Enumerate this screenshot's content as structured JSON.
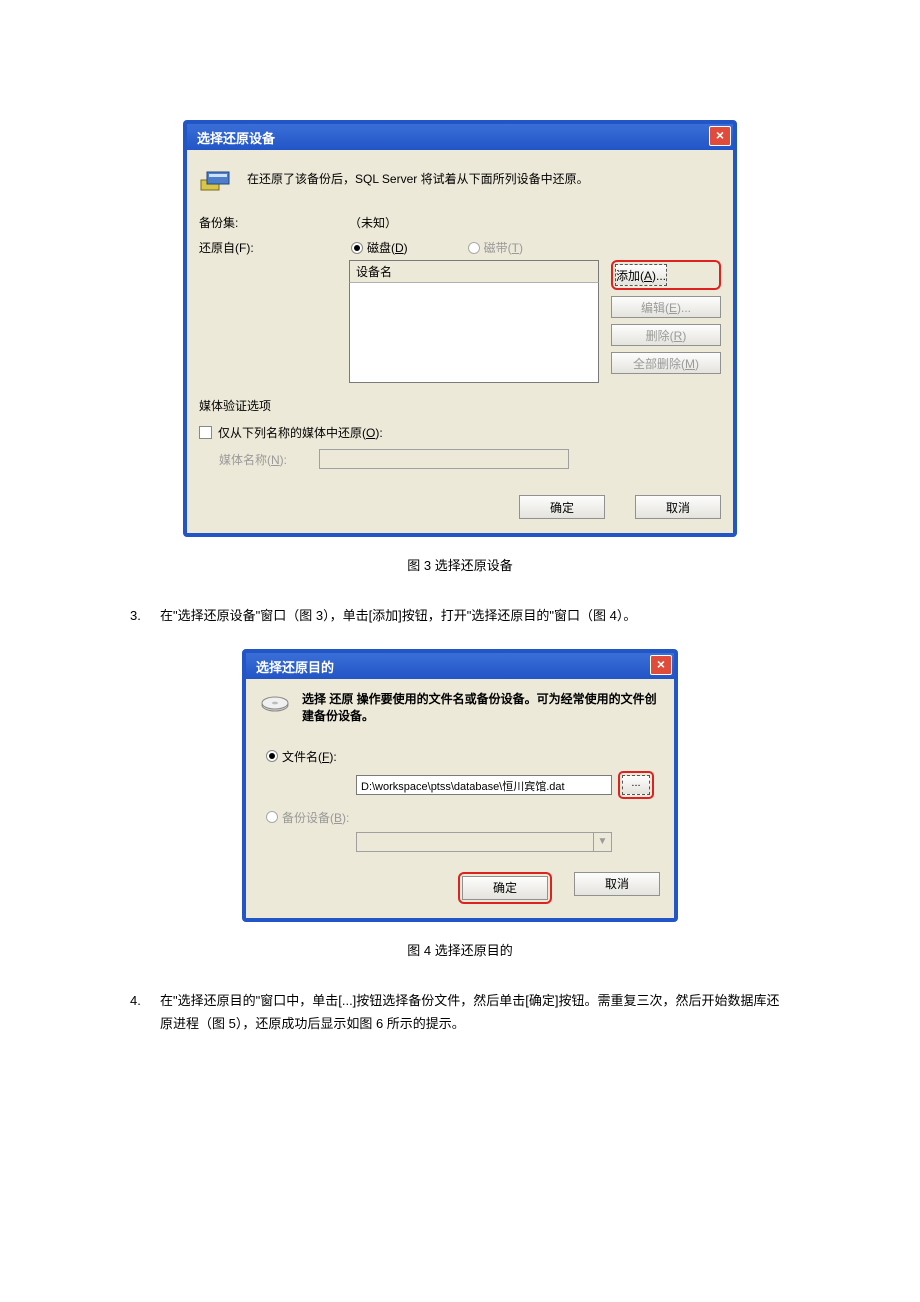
{
  "dlg1": {
    "title": "选择还原设备",
    "info": "在还原了该备份后，SQL Server 将试着从下面所列设备中还原。",
    "backupset_label": "备份集:",
    "backupset_value": "（未知）",
    "restore_from_label": "还原自(F):",
    "radio_disk": "磁盘(D)",
    "radio_tape": "磁带(T)",
    "device_header": "设备名",
    "btn_add": "添加(A)...",
    "btn_edit": "编辑(E)...",
    "btn_delete": "删除(R)",
    "btn_delete_all": "全部删除(M)",
    "media_header": "媒体验证选项",
    "chk_only_media": "仅从下列名称的媒体中还原(O):",
    "media_name_label": "媒体名称(N):",
    "ok": "确定",
    "cancel": "取消"
  },
  "caption1": "图 3  选择还原设备",
  "para3": {
    "num": "3.",
    "text": "在\"选择还原设备\"窗口（图 3），单击[添加]按钮，打开\"选择还原目的\"窗口（图 4）。"
  },
  "dlg2": {
    "title": "选择还原目的",
    "info": "选择 还原 操作要使用的文件名或备份设备。可为经常使用的文件创建备份设备。",
    "radio_file": "文件名(F):",
    "file_value": "D:\\workspace\\ptss\\database\\恒川宾馆.dat",
    "browse": "...",
    "radio_device": "备份设备(B):",
    "ok": "确定",
    "cancel": "取消"
  },
  "caption2": "图 4  选择还原目的",
  "para4": {
    "num": "4.",
    "text": "在\"选择还原目的\"窗口中，单击[...]按钮选择备份文件，然后单击[确定]按钮。需重复三次，然后开始数据库还原进程（图 5），还原成功后显示如图 6 所示的提示。"
  }
}
